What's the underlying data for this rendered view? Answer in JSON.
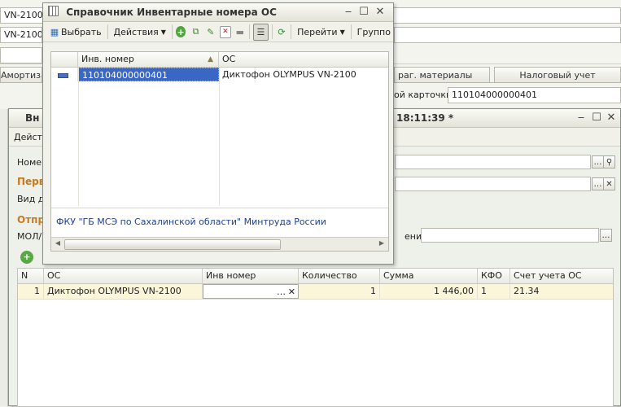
{
  "bg": {
    "field1": "VN-2100",
    "field2": "VN-2100",
    "tab_amort": "Амортиза",
    "tab_materials": "раг. материалы",
    "tab_tax": "Налоговый учет",
    "card_label": "ой карточки:",
    "card_value": "110104000000401"
  },
  "doc": {
    "title_visible": "Вн",
    "title_time": "18:11:39 *",
    "actions_partial": "Дейст",
    "nomer_label": "Номер",
    "group_label": "Перв",
    "vid_label": "Вид до",
    "otv_label": "Отпр",
    "mol_label": "МОЛ/",
    "naznach_label": "ение:",
    "grid": {
      "headers": [
        "N",
        "ОС",
        "Инв номер",
        "Количество",
        "Сумма",
        "КФО",
        "Счет учета ОС"
      ],
      "rows": [
        {
          "n": "1",
          "os": "Диктофон OLYMPUS VN-2100",
          "inv": "",
          "qty": "1",
          "sum": "1 446,00",
          "kfo": "1",
          "account": "21.34"
        }
      ]
    }
  },
  "dialog": {
    "title": "Справочник Инвентарные номера ОС",
    "toolbar": {
      "select": "Выбрать",
      "actions": "Действия",
      "goto": "Перейти",
      "groups": "Группо"
    },
    "grid": {
      "col_inv": "Инв. номер",
      "col_os": "ОС",
      "rows": [
        {
          "inv": "110104000000401",
          "os": "Диктофон OLYMPUS VN-2100"
        }
      ]
    },
    "footer": "ФКУ \"ГБ МСЭ по Сахалинской области\" Минтруда России"
  },
  "colors": {
    "selection": "#3a66c4",
    "footer_text": "#1f3f97",
    "section_orange": "#c97a1c"
  }
}
